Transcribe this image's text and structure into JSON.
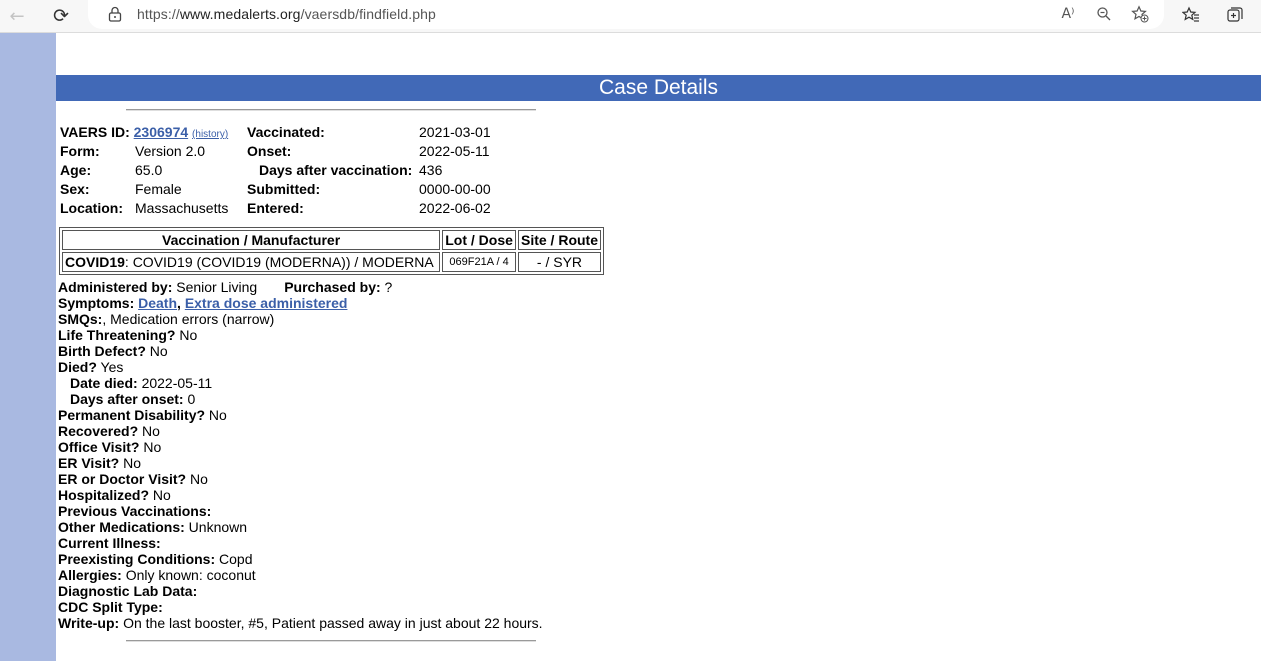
{
  "browser": {
    "url_prefix": "https://",
    "url_domain": "www.medalerts.org",
    "url_path": "/vaersdb/findfield.php",
    "read_aloud_label": "A⁾"
  },
  "page": {
    "banner_title": "Case Details",
    "colors": {
      "banner": "#4169b7",
      "sidebar": "#a9b9e1",
      "link": "#3b5fa8"
    }
  },
  "summary": {
    "vaers_id_label": "VAERS ID:",
    "vaers_id": "2306974",
    "history_link": "(history)",
    "form_label": "Form:",
    "form_value": "Version 2.0",
    "age_label": "Age:",
    "age_value": "65.0",
    "sex_label": "Sex:",
    "sex_value": "Female",
    "location_label": "Location:",
    "location_value": "Massachusetts",
    "vaccinated_label": "Vaccinated:",
    "vaccinated_value": "2021-03-01",
    "onset_label": "Onset:",
    "onset_value": "2022-05-11",
    "days_after_label": "Days after vaccination:",
    "days_after_value": "436",
    "submitted_label": "Submitted:",
    "submitted_value": "0000-00-00",
    "entered_label": "Entered:",
    "entered_value": "2022-06-02"
  },
  "vaccination_table": {
    "headers": [
      "Vaccination / Manufacturer",
      "Lot / Dose",
      "Site / Route"
    ],
    "row": {
      "vaccine_type": "COVID19",
      "vaccine_desc": ": COVID19 (COVID19 (MODERNA)) / MODERNA",
      "lot_dose": "069F21A / 4",
      "site_route": "- / SYR"
    }
  },
  "details": {
    "administered_by_label": "Administered by:",
    "administered_by_value": " Senior Living",
    "purchased_by_label": "Purchased by:",
    "purchased_by_value": " ?",
    "symptoms_label": "Symptoms:",
    "symptoms": [
      "Death",
      "Extra dose administered"
    ],
    "smqs_label": "SMQs:",
    "smqs_value": ", Medication errors (narrow)",
    "life_threatening_label": "Life Threatening?",
    "life_threatening_value": " No",
    "birth_defect_label": "Birth Defect?",
    "birth_defect_value": " No",
    "died_label": "Died?",
    "died_value": " Yes",
    "date_died_label": "Date died:",
    "date_died_value": " 2022-05-11",
    "days_after_onset_label": "Days after onset:",
    "days_after_onset_value": " 0",
    "permanent_disability_label": "Permanent Disability?",
    "permanent_disability_value": " No",
    "recovered_label": "Recovered?",
    "recovered_value": " No",
    "office_visit_label": "Office Visit?",
    "office_visit_value": " No",
    "er_visit_label": "ER Visit?",
    "er_visit_value": " No",
    "er_doctor_visit_label": "ER or Doctor Visit?",
    "er_doctor_visit_value": " No",
    "hospitalized_label": "Hospitalized?",
    "hospitalized_value": " No",
    "previous_vaccinations_label": "Previous Vaccinations:",
    "other_medications_label": "Other Medications:",
    "other_medications_value": " Unknown",
    "current_illness_label": "Current Illness:",
    "preexisting_label": "Preexisting Conditions:",
    "preexisting_value": " Copd",
    "allergies_label": "Allergies:",
    "allergies_value": " Only known: coconut",
    "diagnostic_label": "Diagnostic Lab Data:",
    "cdc_split_label": "CDC Split Type:",
    "writeup_label": "Write-up:",
    "writeup_value": " On the last booster, #5, Patient passed away in just about 22 hours."
  }
}
